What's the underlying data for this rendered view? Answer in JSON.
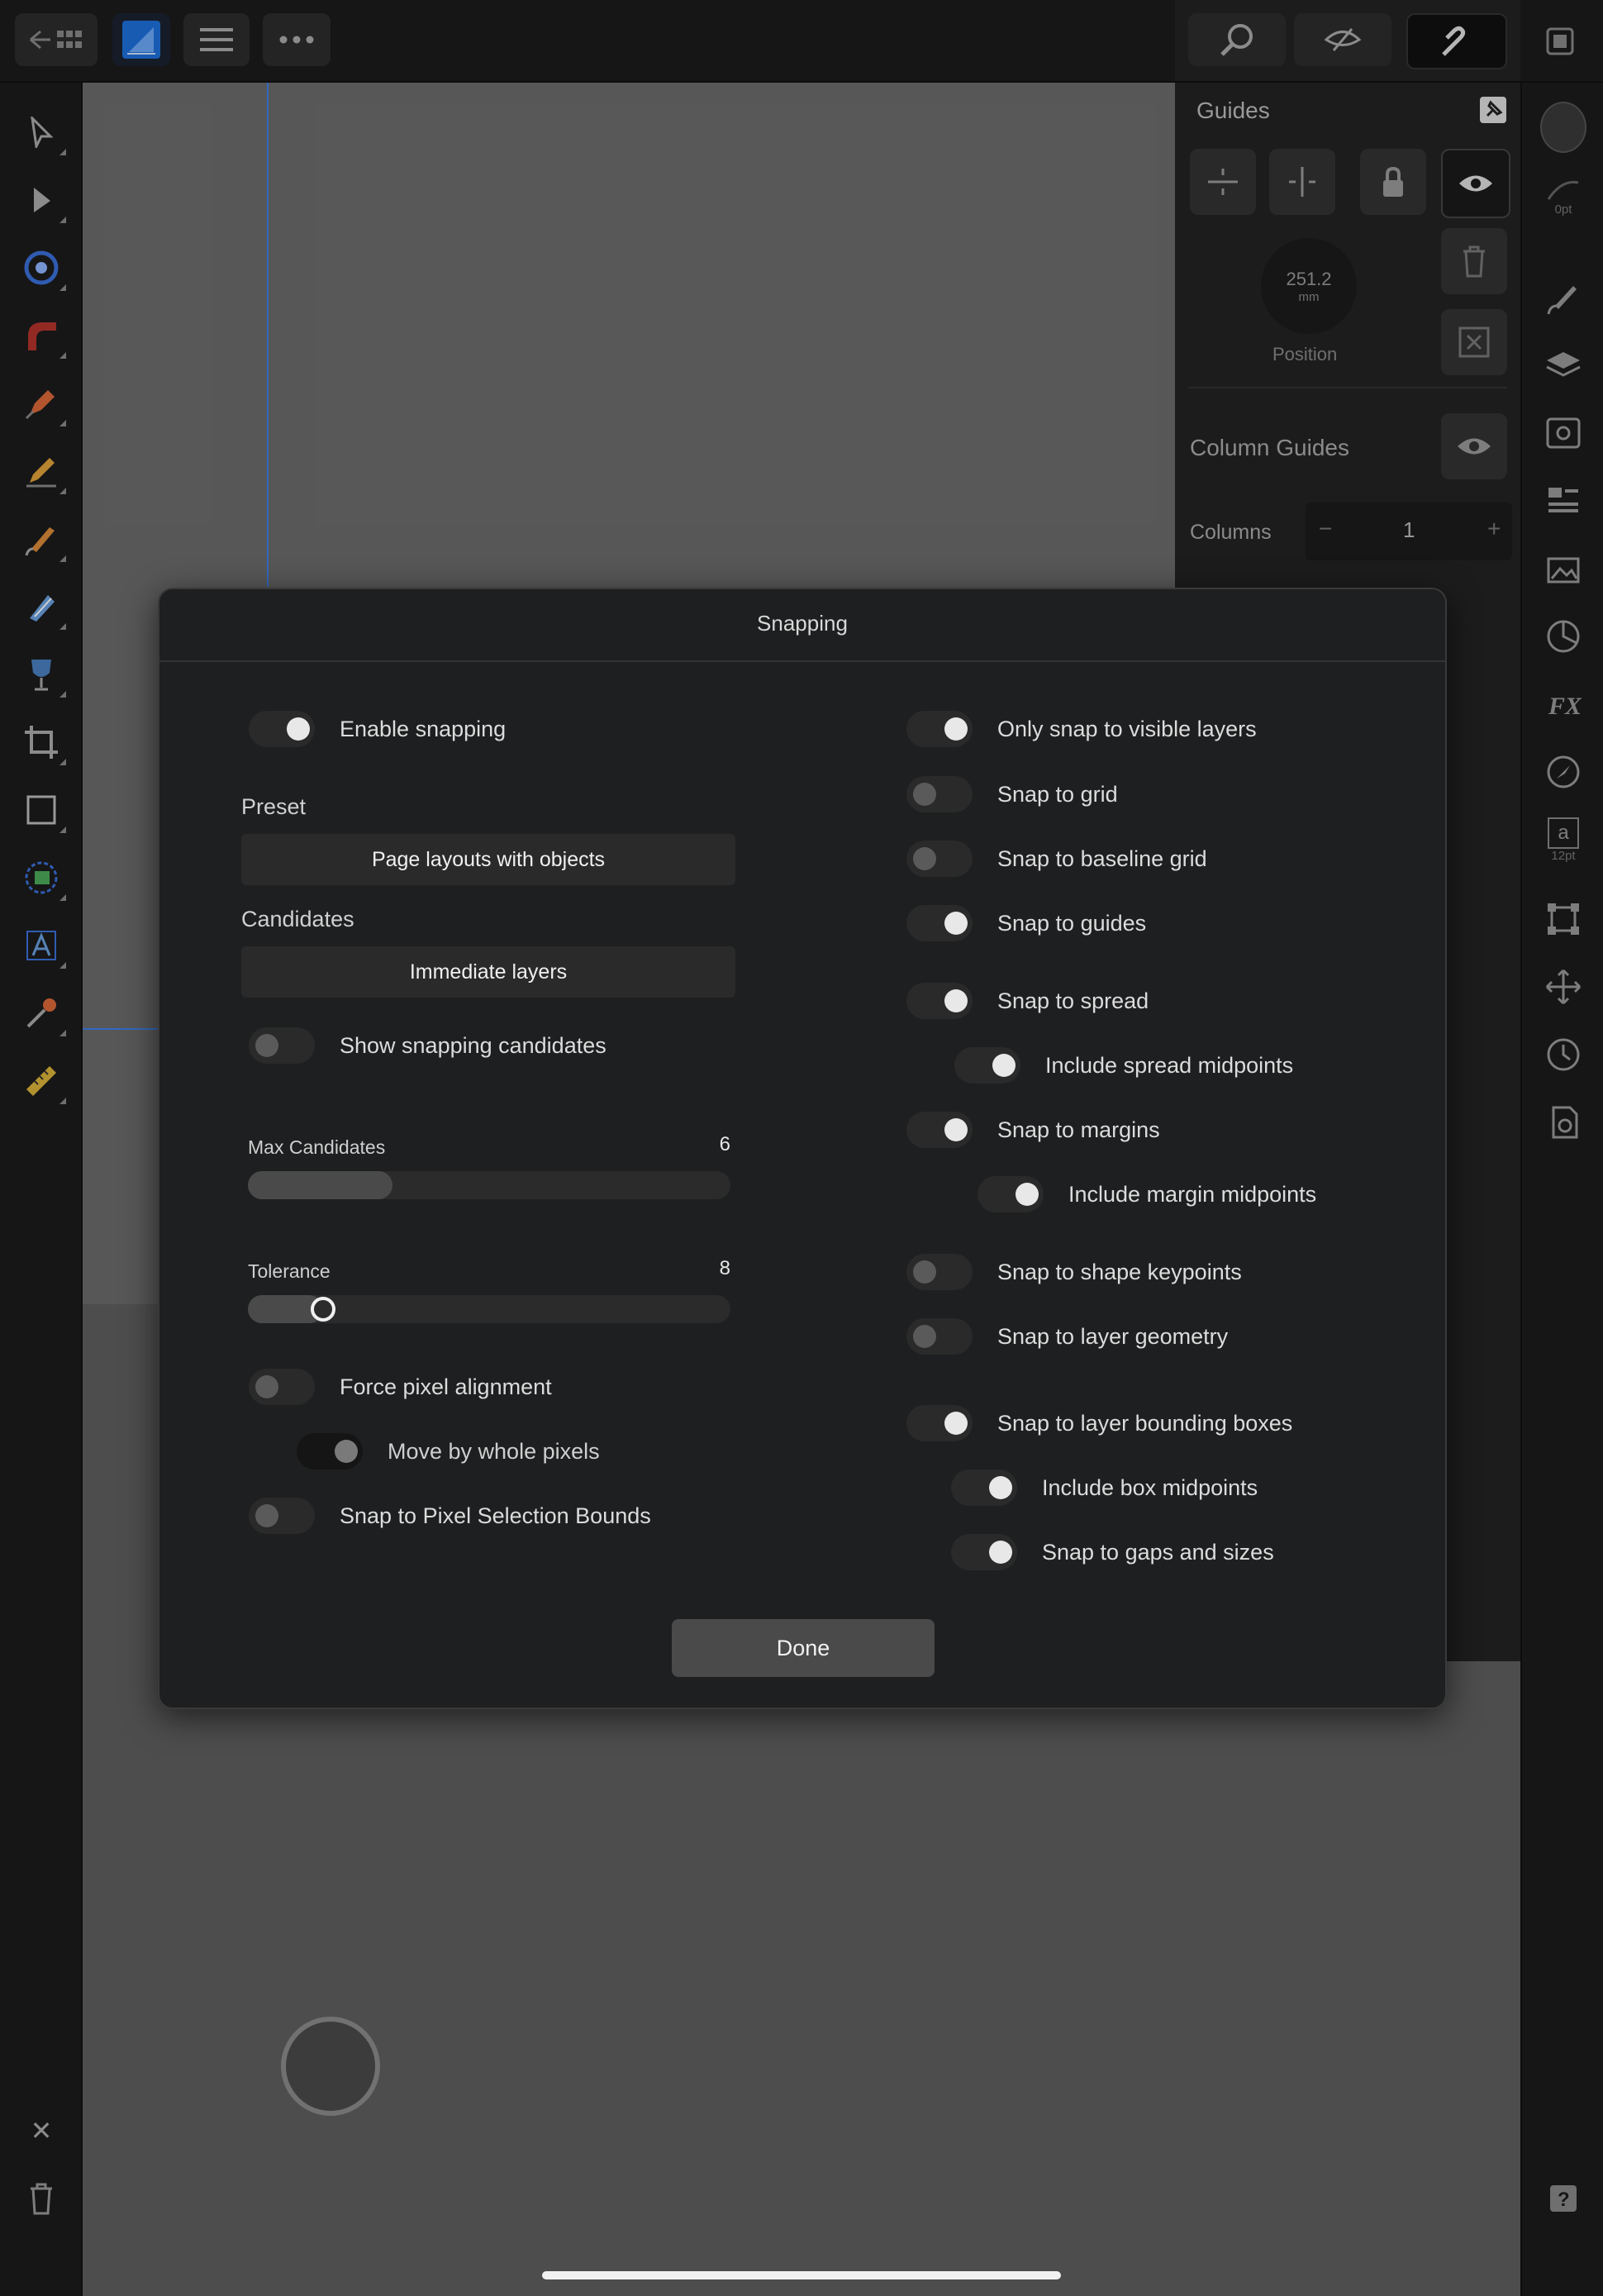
{
  "guides_panel": {
    "title": "Guides",
    "position_value": "251.2",
    "position_unit": "mm",
    "position_label": "Position",
    "column_guides_label": "Column Guides",
    "columns_label": "Columns",
    "columns_value": "1",
    "minus": "−",
    "plus": "+"
  },
  "right_strip": {
    "stroke_width": "0pt",
    "font_size": "12pt",
    "text_glyph": "a"
  },
  "left_tools": {
    "close_glyph": "✕"
  },
  "modal": {
    "title": "Snapping",
    "left": {
      "enable_snapping": {
        "label": "Enable snapping",
        "on": true
      },
      "preset_label": "Preset",
      "preset_value": "Page layouts with objects",
      "candidates_label": "Candidates",
      "candidates_value": "Immediate layers",
      "show_candidates": {
        "label": "Show snapping candidates",
        "on": false
      },
      "max_candidates": {
        "label": "Max Candidates",
        "value": "6",
        "fraction": 0.3
      },
      "tolerance": {
        "label": "Tolerance",
        "value": "8",
        "fraction": 0.13
      },
      "force_pixel": {
        "label": "Force pixel alignment",
        "on": false
      },
      "move_whole_pixels": {
        "label": "Move by whole pixels",
        "on": true
      },
      "snap_pixel_bounds": {
        "label": "Snap to Pixel Selection Bounds",
        "on": false
      }
    },
    "right": [
      {
        "label": "Only snap to visible layers",
        "on": true
      },
      {
        "label": "Snap to grid",
        "on": false
      },
      {
        "label": "Snap to baseline grid",
        "on": false
      },
      {
        "label": "Snap to guides",
        "on": true
      },
      {
        "label": "Snap to spread",
        "on": true
      },
      {
        "label": "Include spread midpoints",
        "on": true
      },
      {
        "label": "Snap to margins",
        "on": true
      },
      {
        "label": "Include margin midpoints",
        "on": true
      },
      {
        "label": "Snap to shape keypoints",
        "on": false
      },
      {
        "label": "Snap to layer geometry",
        "on": false
      },
      {
        "label": "Snap to layer bounding boxes",
        "on": true
      },
      {
        "label": "Include box midpoints",
        "on": true
      },
      {
        "label": "Snap to gaps and sizes",
        "on": true
      }
    ],
    "done_label": "Done"
  },
  "colors": {
    "accent": "#3b82f6",
    "panel": "#1e1f20",
    "toolbar": "#1c1c1c"
  }
}
